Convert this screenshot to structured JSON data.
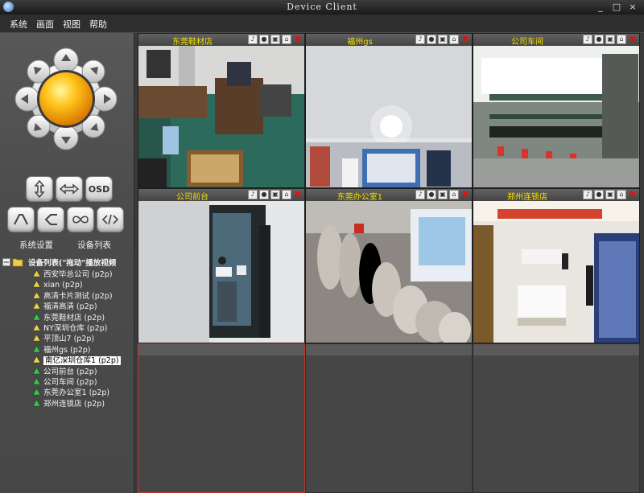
{
  "window": {
    "title": "Device Client",
    "controls": [
      "_",
      "□",
      "×"
    ]
  },
  "menu": [
    "系统",
    "画面",
    "视图",
    "帮助"
  ],
  "ptz": {
    "center_color": "#f0a800",
    "buttons_row1": [
      "up-down-icon",
      "left-right-icon",
      "OSD"
    ],
    "buttons_row2": [
      "zoom-in-icon",
      "zoom-out-icon",
      "loop-icon",
      "focus-icon"
    ],
    "osd_label": "OSD"
  },
  "panel_labels": {
    "settings": "系统设置",
    "devices": "设备列表"
  },
  "tree": {
    "root": "设备列表(\"拖动\"播放视频",
    "items": [
      {
        "label": "西安毕总公司 (p2p)",
        "status": "offline"
      },
      {
        "label": "xian (p2p)",
        "status": "offline"
      },
      {
        "label": "高清卡片测试 (p2p)",
        "status": "offline"
      },
      {
        "label": "福清高清 (p2p)",
        "status": "offline"
      },
      {
        "label": "东莞鞋材店 (p2p)",
        "status": "online"
      },
      {
        "label": "NY深圳仓库 (p2p)",
        "status": "offline"
      },
      {
        "label": "平顶山7 (p2p)",
        "status": "offline"
      },
      {
        "label": "福州gs (p2p)",
        "status": "online"
      },
      {
        "label": "南亿深圳仓库1 (p2p)",
        "status": "offline",
        "selected": true
      },
      {
        "label": "公司前台 (p2p)",
        "status": "online"
      },
      {
        "label": "公司车间 (p2p)",
        "status": "online"
      },
      {
        "label": "东莞办公室1 (p2p)",
        "status": "online"
      },
      {
        "label": "郑州连锁店 (p2p)",
        "status": "online"
      }
    ]
  },
  "cameras": [
    {
      "name": "东莞鞋材店"
    },
    {
      "name": "福州gs"
    },
    {
      "name": "公司车间"
    },
    {
      "name": "公司前台"
    },
    {
      "name": "东莞办公室1"
    },
    {
      "name": "郑州连锁店"
    }
  ],
  "colors": {
    "title_text": "#f5e100",
    "online": "#2ecc40",
    "offline": "#e8d840",
    "active_frame": "#c0392b"
  }
}
